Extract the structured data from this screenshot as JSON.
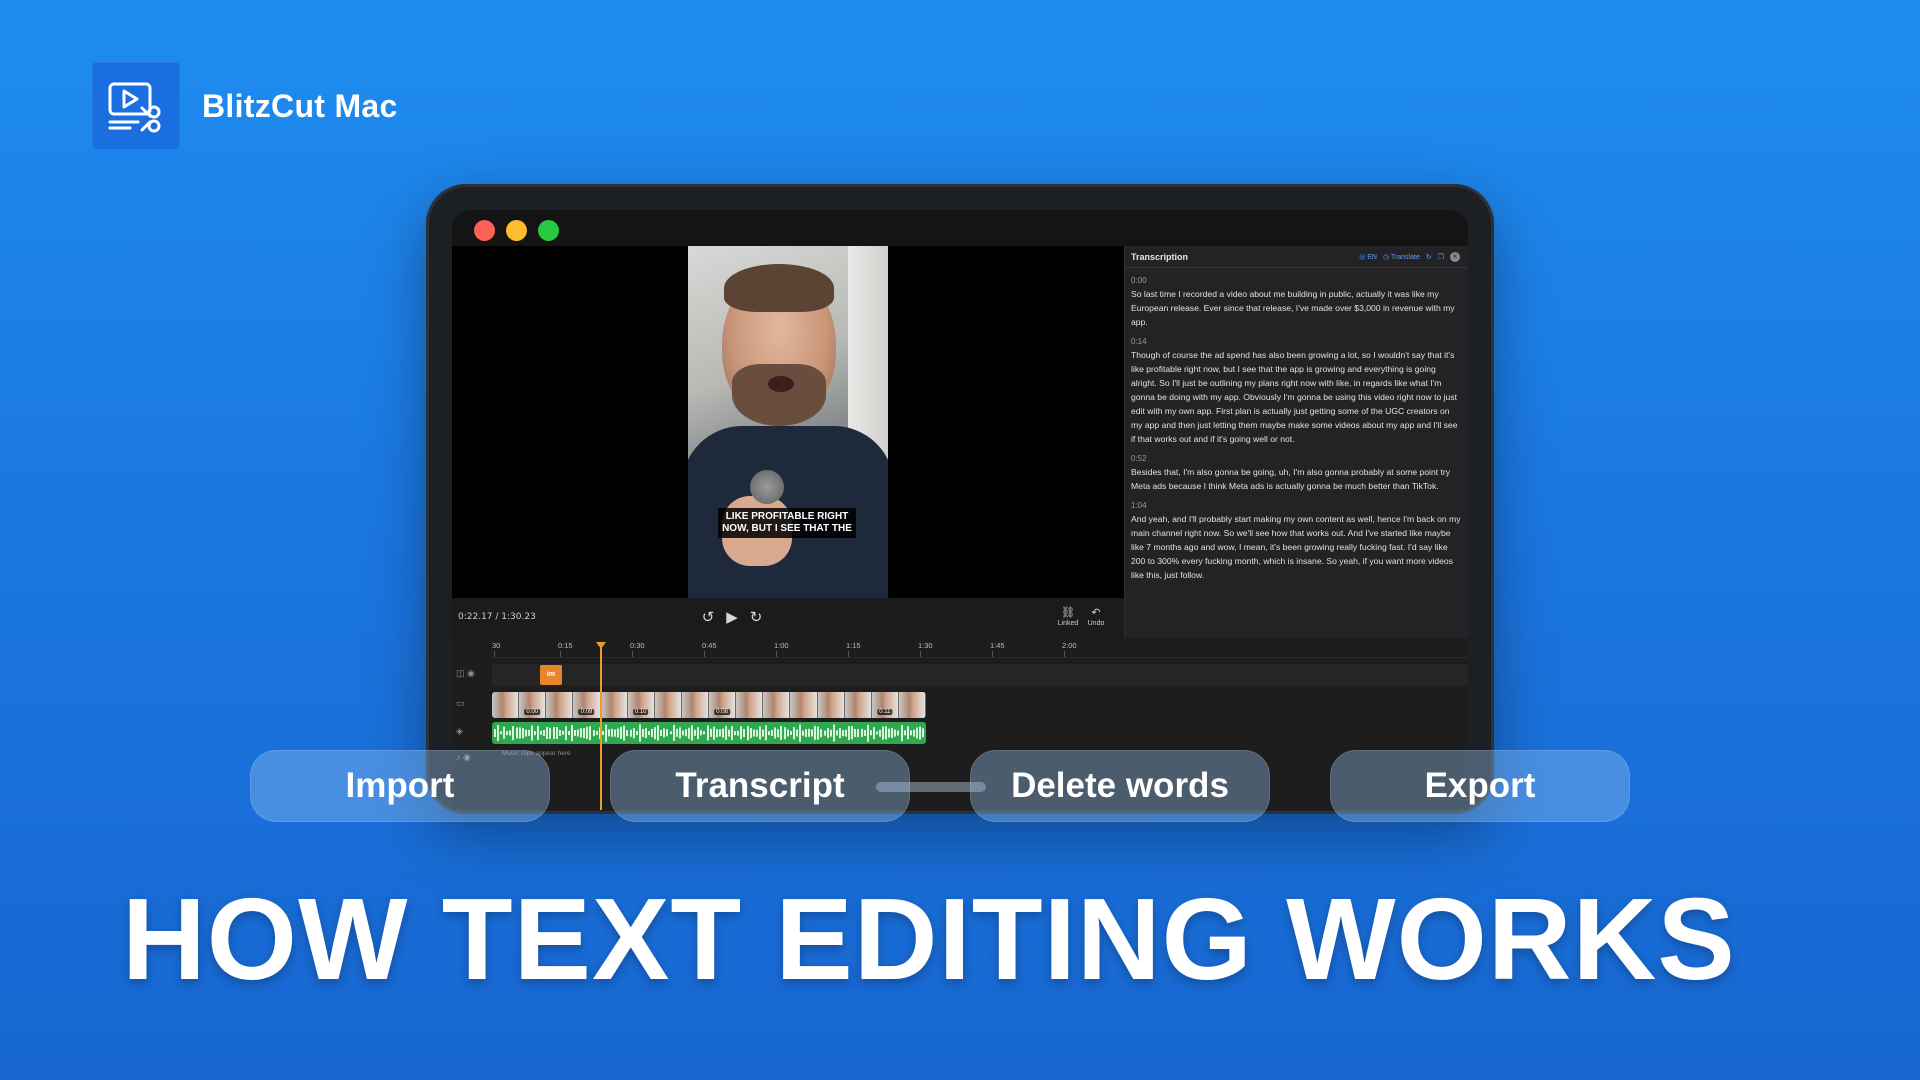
{
  "brand": {
    "name": "BlitzCut Mac",
    "logo_icon": "video-scissors-icon",
    "color": "#1a6fe0"
  },
  "player": {
    "subtitle": "LIKE PROFITABLE RIGHT NOW, BUT I SEE THAT THE",
    "timecode": "0:22.17 / 1:30.23",
    "linked_label": "Linked",
    "undo_label": "Undo"
  },
  "transcription": {
    "title": "Transcription",
    "lang": "EN",
    "translate_label": "Translate",
    "segments": [
      {
        "time": "0:00",
        "text": "So last time I recorded a video about me building in public, actually it was like my European release. Ever since that release, I've made over $3,000 in revenue with my app."
      },
      {
        "time": "0:14",
        "text": "Though of course the ad spend has also been growing a lot, so I wouldn't say that it's like profitable right now, but I see that the app is growing and everything is going alright. So I'll just be outlining my plans right now with like, in regards like what I'm gonna be doing with my app. Obviously I'm gonna be using this video right now to just edit with my own app. First plan is actually just getting some of the UGC creators on my app and then just letting them maybe make some videos about my app and I'll see if that works out and if it's going well or not."
      },
      {
        "time": "0:52",
        "text": "Besides that, I'm also gonna be going, uh, I'm also gonna probably at some point try Meta ads because I think Meta ads is actually gonna be much better than TikTok."
      },
      {
        "time": "1:04",
        "text": "And yeah, and I'll probably start making my own content as well, hence I'm back on my main channel right now. So we'll see how that works out. And I've started like maybe like 7 months ago and wow, I mean, it's been growing really fucking fast. I'd say like 200 to 300% every fucking month, which is insane. So yeah, if you want more videos like this, just follow."
      }
    ]
  },
  "timeline": {
    "ruler": [
      "30",
      "0:15",
      "0:30",
      "0:45",
      "1:00",
      "1:15",
      "1:30",
      "1:45",
      "2:00"
    ],
    "text_clip_label": "im",
    "thumb_labels": [
      "",
      "0:00",
      "",
      "0:09",
      "",
      "0:10",
      "",
      "",
      "0:08",
      "",
      "",
      "",
      "",
      "",
      "0:11",
      ""
    ],
    "music_hint": "Music clips appear here",
    "playhead_color": "#f09a2b",
    "audio_color": "#2fa84f"
  },
  "steps": {
    "import": "Import",
    "transcript": "Transcript",
    "delete_words": "Delete words",
    "export": "Export"
  },
  "headline": "HOW TEXT EDITING WORKS"
}
